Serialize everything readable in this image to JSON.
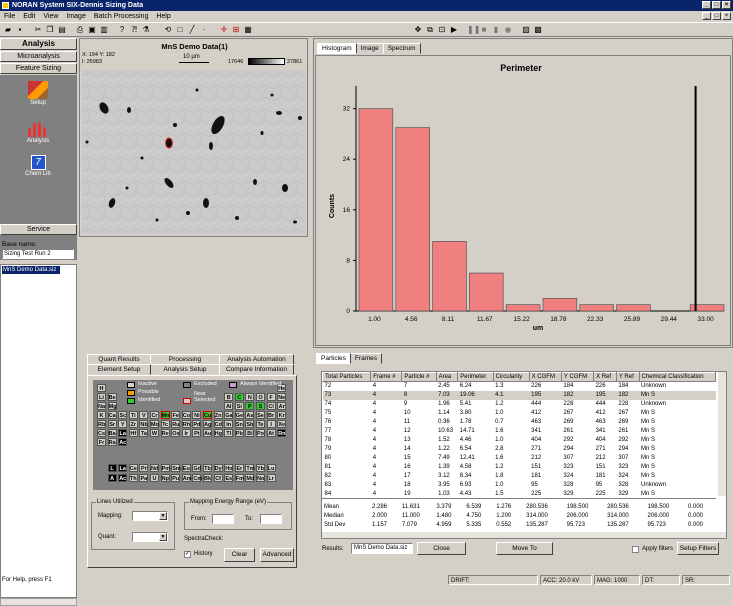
{
  "window": {
    "title": "NORAN System SIX-Dennis Sizing Data"
  },
  "menu": [
    "File",
    "Edit",
    "View",
    "Image",
    "Batch Processing",
    "Help"
  ],
  "nav": {
    "header": "Analysis",
    "microanalysis": "Microanalysis",
    "feature_sizing": "Feature Sizing",
    "items": [
      "Setup",
      "Analysis",
      "Chem Lib"
    ],
    "service": "Service",
    "base_name_label": "Base name:",
    "base_name": "Sizing Test Run 2",
    "selected_file": "MnS Demo Data.siz"
  },
  "image_panel": {
    "title": "MnS Demo Data(1)",
    "coords": "X: 194 Y: 182",
    "intensity": "I: 25983",
    "scale": "10 µm",
    "gray_min": "17646",
    "gray_max": "27861"
  },
  "chart_tabs": [
    "Histogram",
    "Image",
    "Spectrum"
  ],
  "chart_data": {
    "type": "bar",
    "title": "Perimeter",
    "xlabel": "um",
    "ylabel": "Counts",
    "categories": [
      "1.00",
      "4.56",
      "8.11",
      "11.67",
      "15.22",
      "18.78",
      "22.33",
      "25.89",
      "29.44",
      "33.00"
    ],
    "values": [
      32,
      29,
      11,
      6,
      1,
      2,
      1,
      1,
      0,
      1
    ],
    "ylim": [
      0,
      34
    ],
    "yticks": [
      0,
      8,
      16,
      24,
      32
    ],
    "marker_x": "33.00",
    "bar_color": "#f08080"
  },
  "element_setup": {
    "tabs_row1": [
      "Quant Results",
      "Processing",
      "Analysis Automation"
    ],
    "tabs_row2": [
      "Element Setup",
      "Analysis Setup",
      "Compare Information"
    ],
    "legend": {
      "inactive": "Inactive",
      "excluded": "Excluded",
      "always": "Always Identified",
      "possible": "Possible",
      "near": "Near",
      "identified": "Identified",
      "selected": "Selected"
    },
    "lines_utilized": "Lines Utilized",
    "mapping_label": "Mapping:",
    "quant_label": "Quant:",
    "energy_range": "Mapping Energy Range (eV)",
    "from_label": "From:",
    "to_label": "To:",
    "spectracheck": "SpectraCheck:",
    "history": "History",
    "clear": "Clear",
    "advanced": "Advanced",
    "elements": [
      [
        "H",
        0,
        17
      ],
      [
        "He",
        17,
        17
      ],
      [
        "Li",
        0,
        16
      ],
      [
        "Be",
        1,
        16
      ],
      [
        "B",
        12,
        16
      ],
      [
        "C",
        13,
        16
      ],
      [
        "N",
        14,
        16
      ],
      [
        "O",
        15,
        16
      ],
      [
        "F",
        16,
        16
      ],
      [
        "Ne",
        17,
        16
      ],
      [
        "Na",
        0,
        15
      ],
      [
        "Mg",
        1,
        15
      ],
      [
        "Al",
        12,
        15
      ],
      [
        "Si",
        13,
        15
      ],
      [
        "P",
        14,
        15
      ],
      [
        "S",
        15,
        15
      ],
      [
        "Cl",
        16,
        15
      ],
      [
        "Ar",
        17,
        15
      ],
      [
        "K",
        0,
        14
      ],
      [
        "Ca",
        1,
        14
      ],
      [
        "Sc",
        2,
        14
      ],
      [
        "Ti",
        3,
        14
      ],
      [
        "V",
        4,
        14
      ],
      [
        "Cr",
        5,
        14
      ],
      [
        "Mn",
        6,
        14
      ],
      [
        "Fe",
        7,
        14
      ],
      [
        "Co",
        8,
        14
      ],
      [
        "Ni",
        9,
        14
      ],
      [
        "Cu",
        10,
        14
      ],
      [
        "Zn",
        11,
        14
      ],
      [
        "Ga",
        12,
        14
      ],
      [
        "Ge",
        13,
        14
      ],
      [
        "As",
        14,
        14
      ],
      [
        "Se",
        15,
        14
      ],
      [
        "Br",
        16,
        14
      ],
      [
        "Kr",
        17,
        14
      ],
      [
        "Rb",
        0,
        13
      ],
      [
        "Sr",
        1,
        13
      ],
      [
        "Y",
        2,
        13
      ],
      [
        "Zr",
        3,
        13
      ],
      [
        "Nb",
        4,
        13
      ],
      [
        "Mo",
        5,
        13
      ],
      [
        "Tc",
        6,
        13
      ],
      [
        "Ru",
        7,
        13
      ],
      [
        "Rh",
        8,
        13
      ],
      [
        "Pd",
        9,
        13
      ],
      [
        "Ag",
        10,
        13
      ],
      [
        "Cd",
        11,
        13
      ],
      [
        "In",
        12,
        13
      ],
      [
        "Sn",
        13,
        13
      ],
      [
        "Sb",
        14,
        13
      ],
      [
        "Te",
        15,
        13
      ],
      [
        "I",
        16,
        13
      ],
      [
        "Xe",
        17,
        13
      ],
      [
        "Cs",
        0,
        12
      ],
      [
        "Ba",
        1,
        12
      ],
      [
        "La",
        2,
        12
      ],
      [
        "Hf",
        3,
        12
      ],
      [
        "Ta",
        4,
        12
      ],
      [
        "W",
        5,
        12
      ],
      [
        "Re",
        6,
        12
      ],
      [
        "Os",
        7,
        12
      ],
      [
        "Ir",
        8,
        12
      ],
      [
        "Pt",
        9,
        12
      ],
      [
        "Au",
        10,
        12
      ],
      [
        "Hg",
        11,
        12
      ],
      [
        "Tl",
        12,
        12
      ],
      [
        "Pb",
        13,
        12
      ],
      [
        "Bi",
        14,
        12
      ],
      [
        "Po",
        15,
        12
      ],
      [
        "At",
        16,
        12
      ],
      [
        "Rn",
        17,
        12
      ],
      [
        "Fr",
        0,
        11
      ],
      [
        "Ra",
        1,
        11
      ],
      [
        "Ac",
        2,
        11
      ]
    ],
    "lanth": [
      "La",
      "Ce",
      "Pr",
      "Nd",
      "Pm",
      "Sm",
      "Eu",
      "Gd",
      "Tb",
      "Dy",
      "Ho",
      "Er",
      "Tm",
      "Yb",
      "Lu"
    ],
    "actin": [
      "Ac",
      "Th",
      "Pa",
      "U",
      "Np",
      "Pu",
      "Am",
      "Cm",
      "Bk",
      "Cf",
      "Es",
      "Fm",
      "Md",
      "No",
      "Lr"
    ],
    "identified": [
      "C",
      "P",
      "S",
      "Mn",
      "Cu"
    ],
    "excluded": [
      "H",
      "He",
      "Li",
      "Be",
      "B",
      "N",
      "O",
      "F",
      "Ne",
      "Na",
      "Mg",
      "Al",
      "Si",
      "Cl",
      "Ar",
      "K",
      "Ca",
      "Sc",
      "Ti",
      "V",
      "Cr",
      "Fe",
      "Co",
      "Ni",
      "Zn",
      "Ga",
      "Ge",
      "As",
      "Se",
      "Br",
      "Kr",
      "Rb",
      "Sr",
      "Y",
      "Zr",
      "Nb",
      "Mo",
      "Tc",
      "Ru",
      "Rh",
      "Pd",
      "Ag",
      "Cd",
      "In",
      "Sn",
      "Sb",
      "Te",
      "I",
      "Xe",
      "Cs",
      "Ba",
      "Hf",
      "Ta",
      "W",
      "Re",
      "Os",
      "Ir",
      "Pt",
      "Au",
      "Hg",
      "Tl",
      "Pb",
      "Bi",
      "Po",
      "At",
      "Fr",
      "Ra"
    ],
    "dark": [
      "Rn",
      "La",
      "Ac"
    ]
  },
  "particles": {
    "tabs": [
      "Particles",
      "Frames"
    ],
    "columns": [
      "Total Particles",
      "Frame #",
      "Particle #",
      "Area",
      "Perimeter",
      "Circularity",
      "X CGFM",
      "Y CGFM",
      "X Ref",
      "Y Ref",
      "Chemical Classification"
    ],
    "rows": [
      [
        "72",
        "4",
        "7",
        "2.45",
        "6.24",
        "1.3",
        "226",
        "184",
        "226",
        "184",
        "Unknown"
      ],
      [
        "73",
        "4",
        "8",
        "7.03",
        "19.06",
        "4.1",
        "195",
        "182",
        "195",
        "182",
        "Mn S"
      ],
      [
        "74",
        "4",
        "9",
        "1.96",
        "5.41",
        "1.2",
        "444",
        "228",
        "444",
        "228",
        "Unknown"
      ],
      [
        "75",
        "4",
        "10",
        "1.14",
        "3.80",
        "1.0",
        "412",
        "267",
        "412",
        "267",
        "Mn S"
      ],
      [
        "76",
        "4",
        "11",
        "0.36",
        "1.78",
        "0.7",
        "463",
        "269",
        "463",
        "269",
        "Mn S"
      ],
      [
        "77",
        "4",
        "12",
        "10.63",
        "14.71",
        "1.6",
        "341",
        "261",
        "341",
        "261",
        "Mn S"
      ],
      [
        "78",
        "4",
        "13",
        "1.52",
        "4.46",
        "1.0",
        "404",
        "292",
        "404",
        "292",
        "Mn S"
      ],
      [
        "79",
        "4",
        "14",
        "1.22",
        "6.54",
        "2.8",
        "271",
        "294",
        "271",
        "294",
        "Mn S"
      ],
      [
        "80",
        "4",
        "15",
        "7.49",
        "12.41",
        "1.6",
        "212",
        "307",
        "212",
        "307",
        "Mn S"
      ],
      [
        "81",
        "4",
        "16",
        "1.39",
        "4.58",
        "1.2",
        "151",
        "323",
        "151",
        "323",
        "Mn S"
      ],
      [
        "82",
        "4",
        "17",
        "3.12",
        "8.34",
        "1.8",
        "181",
        "324",
        "181",
        "324",
        "Mn S"
      ],
      [
        "83",
        "4",
        "18",
        "3.95",
        "6.93",
        "1.0",
        "95",
        "328",
        "95",
        "328",
        "Unknown"
      ],
      [
        "84",
        "4",
        "19",
        "1.03",
        "4.43",
        "1.5",
        "225",
        "329",
        "225",
        "329",
        "Mn S"
      ]
    ],
    "stats": [
      [
        "Mean",
        "2.286",
        "11.631",
        "3.379",
        "6.539",
        "1.276",
        "280.536",
        "198.500",
        "280.536",
        "198.500",
        "0.000"
      ],
      [
        "Median",
        "2.000",
        "11.000",
        "1.480",
        "4.750",
        "1.200",
        "314.000",
        "206.000",
        "314.000",
        "206.000",
        "0.000"
      ],
      [
        "Std Dev",
        "1.157",
        "7.079",
        "4.959",
        "5.335",
        "0.552",
        "135.287",
        "95.723",
        "135.287",
        "95.723",
        "0.000"
      ]
    ],
    "results_label": "Results:",
    "results_value": "MnS Demo Data.siz",
    "close": "Close",
    "move_to": "Move To",
    "apply_filters": "Apply filters",
    "setup_filters": "Setup Filters"
  },
  "status": {
    "help": "For Help, press F1",
    "drift": "DRIFT:",
    "acc": "ACC: 20.0 kV",
    "mag": "MAG: 1000",
    "dt": "DT:",
    "sr": "SR:"
  }
}
